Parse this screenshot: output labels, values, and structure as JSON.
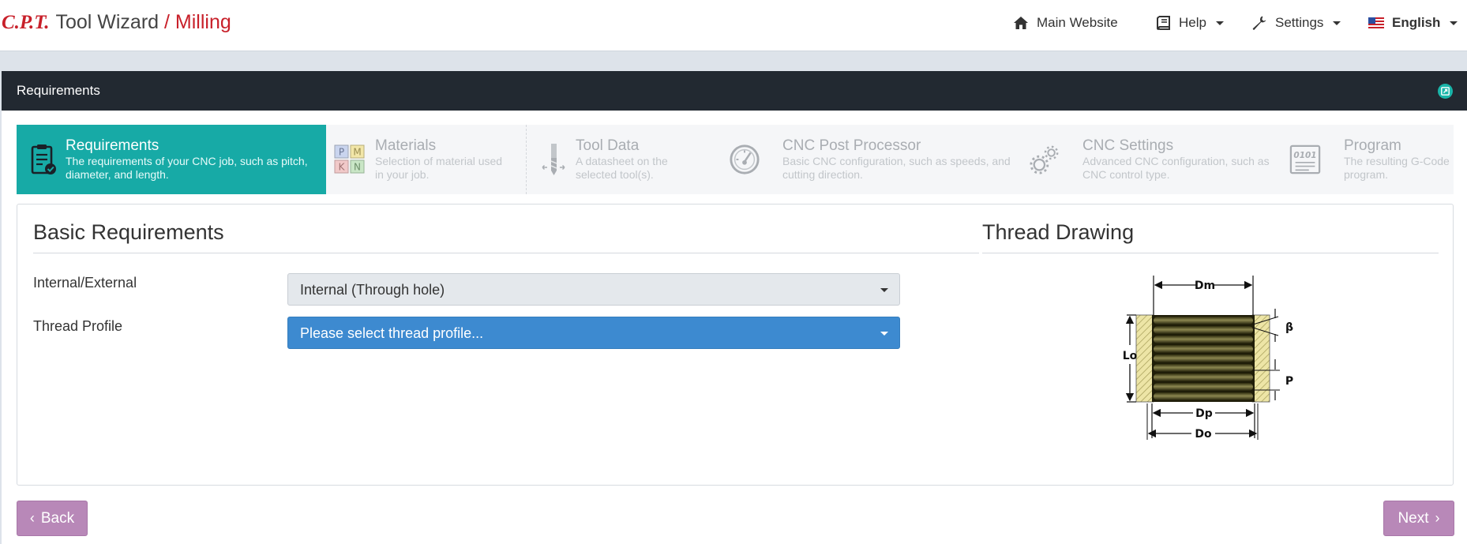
{
  "brand": {
    "logo": "C.P.T.",
    "app": "Tool Wizard",
    "separator": "/",
    "module": "Milling"
  },
  "nav": {
    "main_website": "Main Website",
    "help": "Help",
    "settings": "Settings",
    "language": "English"
  },
  "panel": {
    "title": "Requirements"
  },
  "steps": [
    {
      "title": "Requirements",
      "desc_line1": "The requirements of your CNC job, such as pitch,",
      "desc_line2": "diameter, and length.",
      "icon": "clipboard-check-icon"
    },
    {
      "title": "Materials",
      "desc_line1": "Selection of material used",
      "desc_line2": "in your job.",
      "icon": "materials-pmkn-icon",
      "letters": [
        "P",
        "M",
        "K",
        "N"
      ]
    },
    {
      "title": "Tool Data",
      "desc_line1": "A datasheet on the",
      "desc_line2": "selected tool(s).",
      "icon": "end-mill-icon"
    },
    {
      "title": "CNC Post Processor",
      "desc_line1": "Basic CNC configuration, such as speeds, and",
      "desc_line2": "cutting direction.",
      "icon": "gauge-icon"
    },
    {
      "title": "CNC Settings",
      "desc_line1": "Advanced CNC configuration, such as",
      "desc_line2": "CNC control type.",
      "icon": "gears-icon"
    },
    {
      "title": "Program",
      "desc_line1": "The resulting G-Code",
      "desc_line2": "program.",
      "icon": "binary-document-icon",
      "icon_text": "0101"
    }
  ],
  "basic": {
    "title": "Basic Requirements",
    "internal_external": {
      "label": "Internal/External",
      "value": "Internal (Through hole)"
    },
    "thread_profile": {
      "label": "Thread Profile",
      "placeholder": "Please select thread profile..."
    }
  },
  "drawing": {
    "title": "Thread Drawing",
    "labels": {
      "dm": "Dm",
      "beta": "β",
      "lo": "Lo",
      "p": "P",
      "dp": "Dp",
      "do": "Do"
    }
  },
  "buttons": {
    "back": "Back",
    "next": "Next"
  },
  "colors": {
    "accent": "#17aaa6",
    "brand_red": "#c8202a",
    "select_blue": "#3d8ad0",
    "nav_button": "#b888b8",
    "panel_header": "#222931"
  }
}
